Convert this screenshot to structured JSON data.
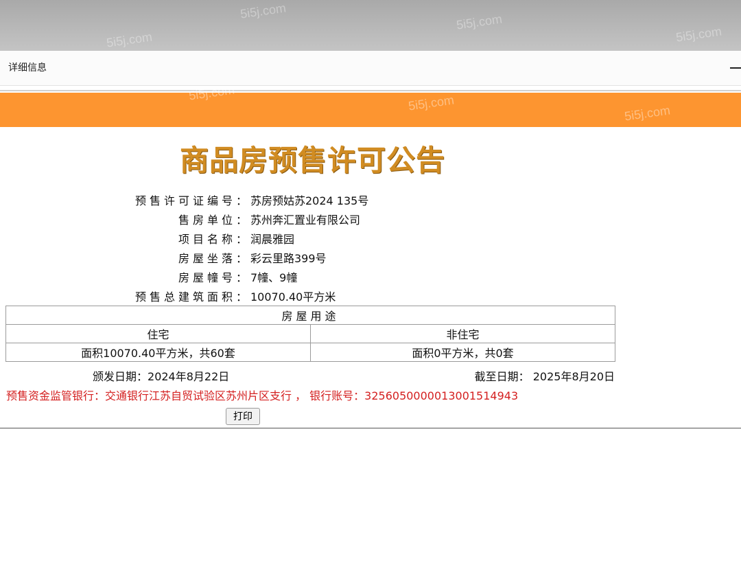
{
  "watermark": "5i5j.com",
  "dialog": {
    "title": "详细信息"
  },
  "notice": {
    "title": "商品房预售许可公告",
    "fields": [
      {
        "label": "预售许可证编号",
        "value": "苏房预姑苏2024 135号"
      },
      {
        "label": "售房单位",
        "value": "苏州奔汇置业有限公司"
      },
      {
        "label": "项目名称",
        "value": "润晨雅园"
      },
      {
        "label": "房屋坐落",
        "value": "彩云里路399号"
      },
      {
        "label": "房屋幢号",
        "value": "7幢、9幢"
      },
      {
        "label": "预售总建筑面积",
        "value": "10070.40平方米"
      }
    ],
    "separator": "：",
    "usage_table": {
      "header": "房屋用途",
      "columns": [
        "住宅",
        "非住宅"
      ],
      "values": [
        "面积10070.40平方米，共60套",
        "面积0平方米，共0套"
      ]
    },
    "issue_date_label": "颁发日期：",
    "issue_date": "2024年8月22日",
    "expiry_date_label": "截至日期：",
    "expiry_date": "2025年8月20日",
    "bank_line": "预售资金监管银行：交通银行江苏自贸试验区苏州片区支行 ，  银行账号：3256050000013001514943",
    "print_label": "打印"
  },
  "colors": {
    "banner": "#fd9530",
    "title": "#d18c22",
    "bank_text": "#d42020"
  }
}
